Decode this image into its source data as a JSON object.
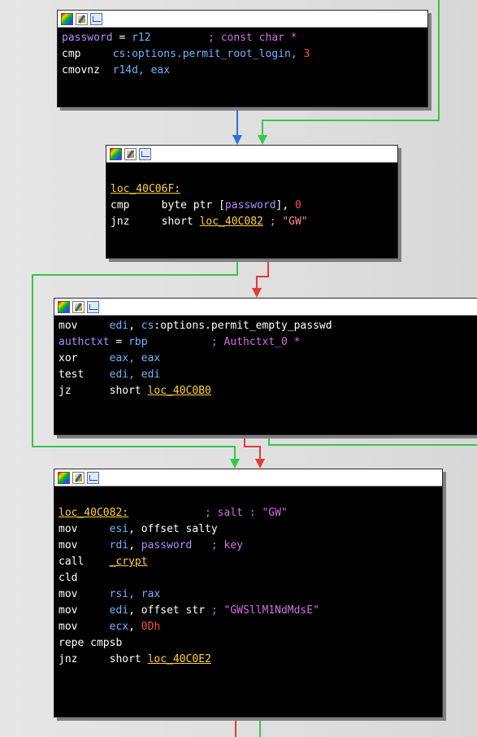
{
  "colors": {
    "edge_green": "#35c84a",
    "edge_red": "#e23a3a",
    "edge_blue": "#2c6fe0",
    "node_bg": "#000000",
    "mnemonic": "#ffffff",
    "register": "#6fb5ff",
    "variable": "#b58cff",
    "comment": "#d070e0",
    "label": "#ffd23a",
    "number": "#ff5050"
  },
  "header_icons": [
    "color-palette-icon",
    "edit-node-icon",
    "graph-overview-icon"
  ],
  "node1": {
    "l1_var": "password",
    "l1_eq": " = ",
    "l1_reg": "r12",
    "l1_pad": "         ",
    "l1_cmt": "; const char *",
    "l2_op": "cmp",
    "l2_sp": "     ",
    "l2_reg": "cs",
    "l2_rest": ":options.permit_root_login, ",
    "l2_num": "3",
    "l3_op": "cmovnz",
    "l3_sp": "  ",
    "l3_args": "r14d, eax"
  },
  "node2": {
    "label": "loc_40C06F:",
    "l2_op": "cmp",
    "l2_sp": "     ",
    "l2_a": "byte ptr [",
    "l2_var": "password",
    "l2_b": "], ",
    "l2_num": "0",
    "l3_op": "jnz",
    "l3_sp": "     ",
    "l3_short": "short ",
    "l3_loc": "loc_40C082",
    "l3_sp2": " ",
    "l3_cmt": "; \"GW\""
  },
  "node3": {
    "l1_op": "mov",
    "l1_sp": "     ",
    "l1_reg": "edi",
    "l1_c": ", ",
    "l1_reg2": "cs",
    "l1_rest": ":options.permit_empty_passwd",
    "l2_var": "authctxt",
    "l2_eq": " = ",
    "l2_reg": "rbp",
    "l2_pad": "          ",
    "l2_cmt": "; Authctxt_0 *",
    "l3_op": "xor",
    "l3_sp": "     ",
    "l3_args": "eax, eax",
    "l4_op": "test",
    "l4_sp": "    ",
    "l4_args": "edi, edi",
    "l5_op": "jz",
    "l5_sp": "      ",
    "l5_short": "short ",
    "l5_loc": "loc_40C0B0"
  },
  "node4": {
    "l1_label": "loc_40C082:",
    "l1_pad": "            ",
    "l1_cmt": "; salt : \"GW\"",
    "l2_op": "mov",
    "l2_sp": "     ",
    "l2_reg": "esi",
    "l2_rest": ", offset salty",
    "l3_op": "mov",
    "l3_sp": "     ",
    "l3_reg": "rdi",
    "l3_c": ", ",
    "l3_var": "password",
    "l3_pad": "   ",
    "l3_cmt": "; key",
    "l4_op": "call",
    "l4_sp": "    ",
    "l4_fn": "_crypt",
    "l5_op": "cld",
    "l6_op": "mov",
    "l6_sp": "     ",
    "l6_args": "rsi, rax",
    "l7_op": "mov",
    "l7_sp": "     ",
    "l7_reg": "edi",
    "l7_rest": ", offset str ",
    "l7_cmt": "; \"GWSllM1NdMdsE\"",
    "l8_op": "mov",
    "l8_sp": "     ",
    "l8_reg": "ecx",
    "l8_c": ", ",
    "l8_num": "0Dh",
    "l9_op": "repe cmpsb",
    "l10_op": "jnz",
    "l10_sp": "     ",
    "l10_short": "short ",
    "l10_loc": "loc_40C0E2"
  }
}
